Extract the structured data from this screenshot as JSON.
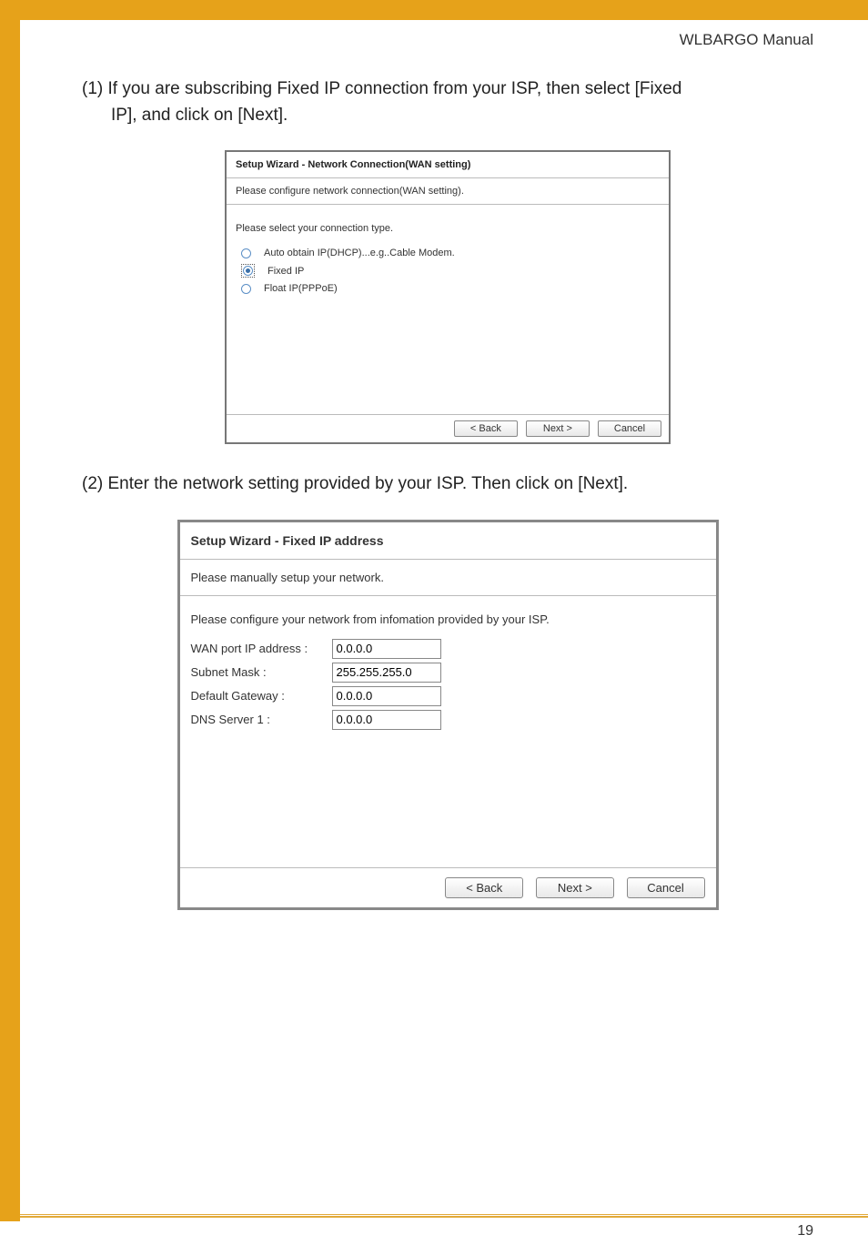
{
  "header": {
    "manual_title": "WLBARGO Manual"
  },
  "step1": {
    "label": "(1) If you are subscribing Fixed IP connection from your ISP, then select [Fixed",
    "label_cont": "IP], and click on [Next]."
  },
  "wizard1": {
    "title": "Setup Wizard - Network Connection(WAN setting)",
    "subtitle": "Please configure network connection(WAN setting).",
    "hint": "Please select your connection type.",
    "options": {
      "dhcp": "Auto obtain IP(DHCP)...e.g..Cable Modem.",
      "fixed": "Fixed IP",
      "pppoe": "Float IP(PPPoE)"
    },
    "buttons": {
      "back": "< Back",
      "next": "Next >",
      "cancel": "Cancel"
    }
  },
  "step2": {
    "label": "(2) Enter the network setting provided by your ISP. Then click on [Next]."
  },
  "wizard2": {
    "title": "Setup Wizard - Fixed IP address",
    "subtitle": "Please manually setup your network.",
    "hint": "Please configure your network from infomation provided by your ISP.",
    "fields": {
      "wan_ip": {
        "label": "WAN port IP address :",
        "value": "0.0.0.0"
      },
      "subnet": {
        "label": "Subnet Mask :",
        "value": "255.255.255.0"
      },
      "gateway": {
        "label": "Default Gateway :",
        "value": "0.0.0.0"
      },
      "dns1": {
        "label": "DNS Server 1 :",
        "value": "0.0.0.0"
      }
    },
    "buttons": {
      "back": "< Back",
      "next": "Next >",
      "cancel": "Cancel"
    }
  },
  "page_number": "19"
}
